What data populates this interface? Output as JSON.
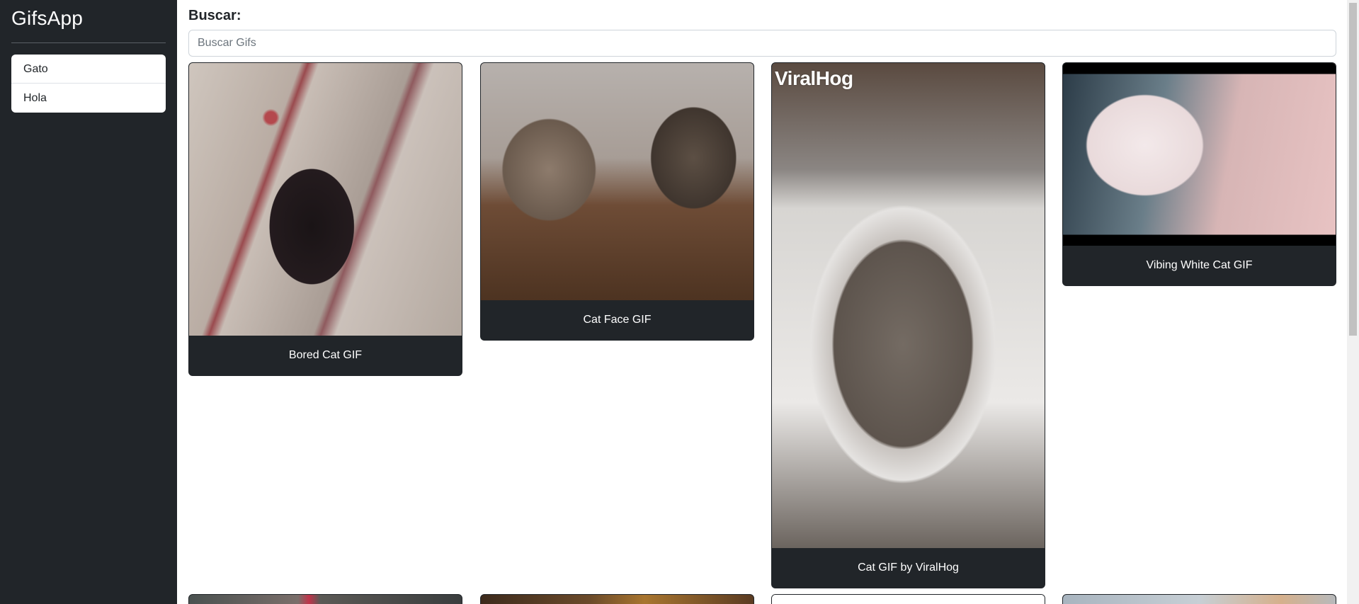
{
  "sidebar": {
    "brand": "GifsApp",
    "history": [
      "Gato",
      "Hola"
    ]
  },
  "search": {
    "label": "Buscar:",
    "placeholder": "Buscar Gifs",
    "value": ""
  },
  "gifs": [
    {
      "title": "Bored Cat GIF"
    },
    {
      "title": "Cat Face GIF"
    },
    {
      "title": "Cat GIF by ViralHog",
      "watermark": "ViralHog"
    },
    {
      "title": "Vibing White Cat GIF"
    }
  ],
  "colors": {
    "sidebar_bg": "#212529",
    "card_caption_bg": "#212529",
    "text_light": "#ffffff"
  }
}
